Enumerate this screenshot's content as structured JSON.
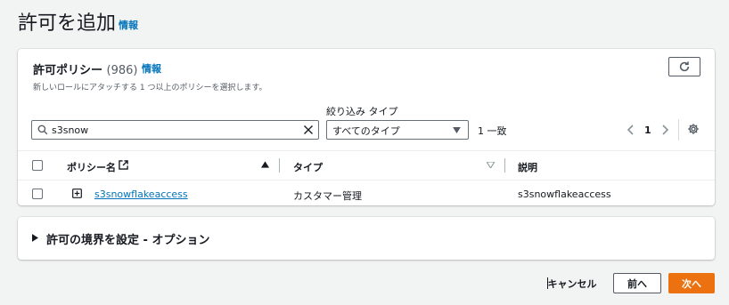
{
  "page": {
    "title": "許可を追加",
    "info_label": "情報"
  },
  "policies": {
    "header": "許可ポリシー",
    "count": "(986)",
    "info_label": "情報",
    "description": "新しいロールにアタッチする 1 つ以上のポリシーを選択します。",
    "refresh_icon": "refresh-icon",
    "filter_label": "絞り込み タイプ",
    "search": {
      "value": "s3snow",
      "placeholder": ""
    },
    "type_filter": {
      "selected": "すべてのタイプ"
    },
    "match_count": "1 一致",
    "pagination": {
      "current_page": "1"
    },
    "columns": {
      "name": "ポリシー名",
      "type": "タイプ",
      "description": "説明"
    },
    "rows": [
      {
        "name": "s3snowflakeaccess",
        "type": "カスタマー管理",
        "description": "s3snowflakeaccess"
      }
    ]
  },
  "boundary": {
    "title": "許可の境界を設定 - オプション"
  },
  "footer": {
    "cancel_label": "キャンセル",
    "prev_label": "前へ",
    "next_label": "次へ"
  },
  "colors": {
    "link": "#0073bb",
    "primary_button": "#ec7211",
    "background": "#f2f3f3"
  }
}
